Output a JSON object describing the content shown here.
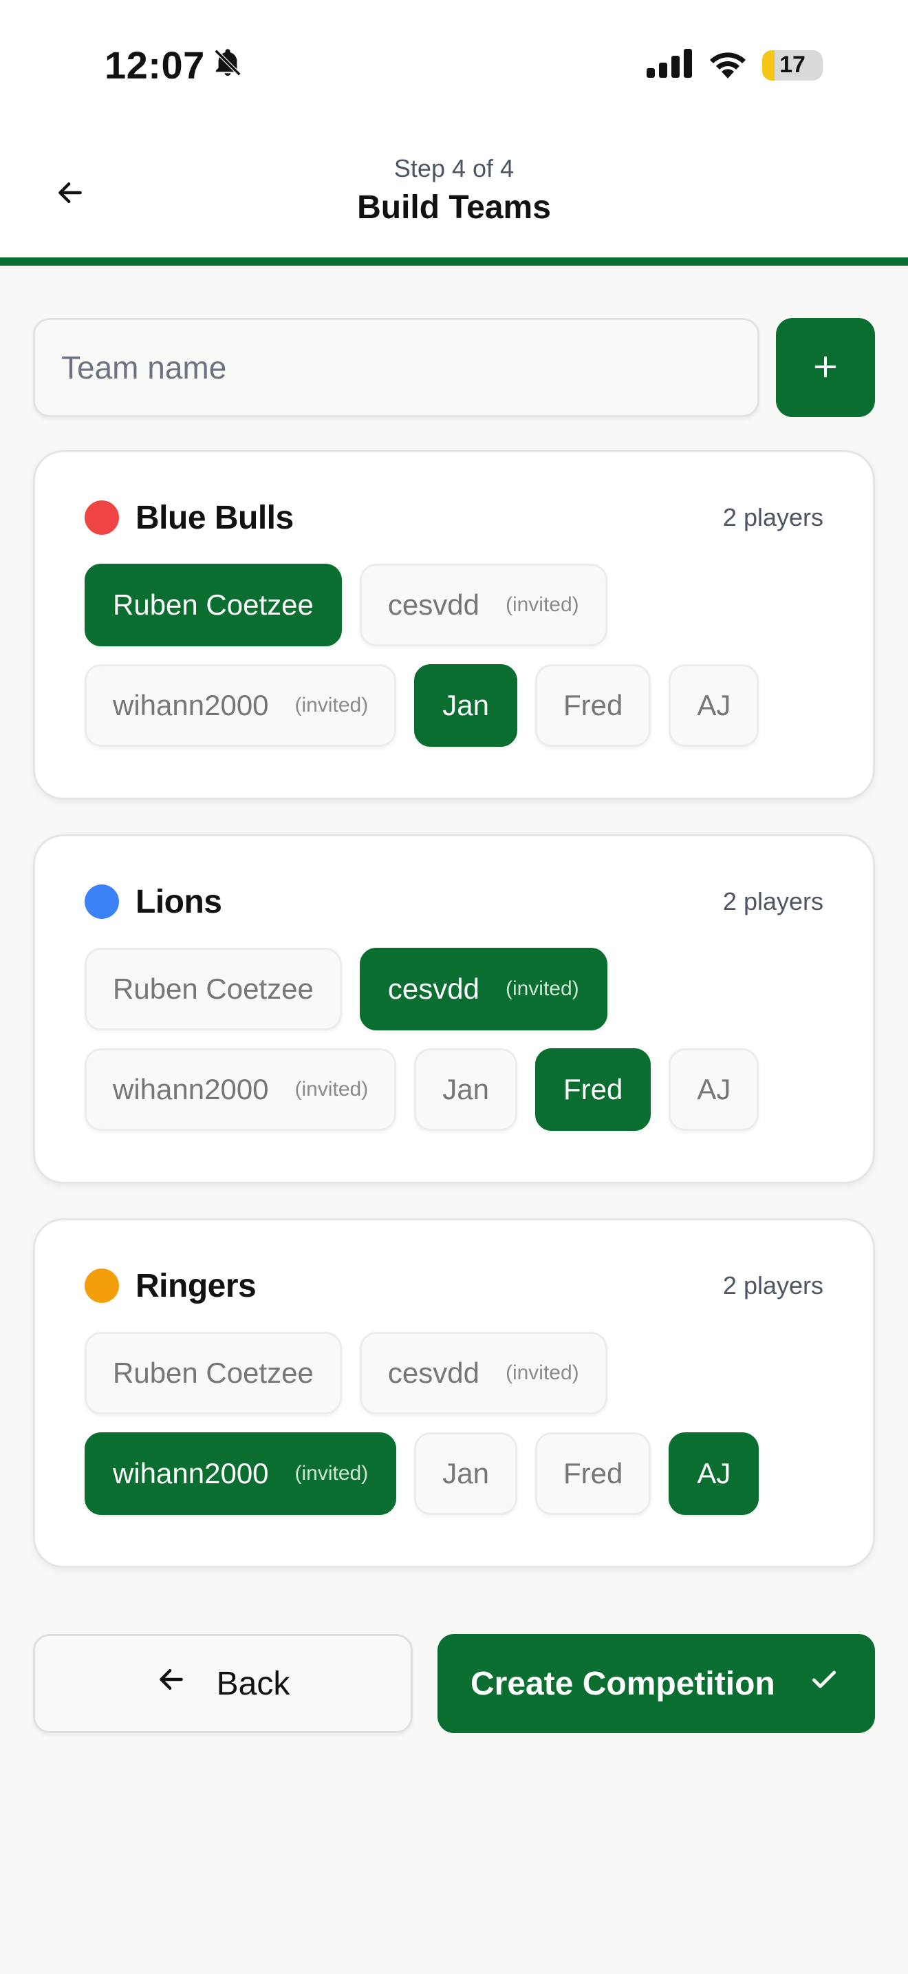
{
  "status_bar": {
    "time": "12:07",
    "battery_level": "17",
    "icons": [
      "bell-slash-icon",
      "cellular-signal-icon",
      "wifi-icon",
      "battery-icon"
    ]
  },
  "header": {
    "step": "Step 4 of 4",
    "title": "Build Teams",
    "back_icon": "arrow-left-icon"
  },
  "colors": {
    "brand_green": "#0a6e31",
    "team_red": "#ef4444",
    "team_blue": "#3b82f6",
    "team_orange": "#f59e0b"
  },
  "add_team": {
    "placeholder": "Team name",
    "value": "",
    "button_icon": "plus-icon"
  },
  "teams": [
    {
      "name": "Blue Bulls",
      "color": "#ef4444",
      "count": "2 players",
      "players": [
        {
          "name": "Ruben Coetzee",
          "tag": "",
          "selected": true
        },
        {
          "name": "cesvdd",
          "tag": "(invited)",
          "selected": false
        },
        {
          "name": "wihann2000",
          "tag": "(invited)",
          "selected": false
        },
        {
          "name": "Jan",
          "tag": "",
          "selected": true
        },
        {
          "name": "Fred",
          "tag": "",
          "selected": false
        },
        {
          "name": "AJ",
          "tag": "",
          "selected": false
        }
      ]
    },
    {
      "name": "Lions",
      "color": "#3b82f6",
      "count": "2 players",
      "players": [
        {
          "name": "Ruben Coetzee",
          "tag": "",
          "selected": false
        },
        {
          "name": "cesvdd",
          "tag": "(invited)",
          "selected": true
        },
        {
          "name": "wihann2000",
          "tag": "(invited)",
          "selected": false
        },
        {
          "name": "Jan",
          "tag": "",
          "selected": false
        },
        {
          "name": "Fred",
          "tag": "",
          "selected": true
        },
        {
          "name": "AJ",
          "tag": "",
          "selected": false
        }
      ]
    },
    {
      "name": "Ringers",
      "color": "#f59e0b",
      "count": "2 players",
      "players": [
        {
          "name": "Ruben Coetzee",
          "tag": "",
          "selected": false
        },
        {
          "name": "cesvdd",
          "tag": "(invited)",
          "selected": false
        },
        {
          "name": "wihann2000",
          "tag": "(invited)",
          "selected": true
        },
        {
          "name": "Jan",
          "tag": "",
          "selected": false
        },
        {
          "name": "Fred",
          "tag": "",
          "selected": false
        },
        {
          "name": "AJ",
          "tag": "",
          "selected": true
        }
      ]
    }
  ],
  "footer": {
    "back_label": "Back",
    "back_icon": "arrow-left-icon",
    "create_label": "Create Competition",
    "create_icon": "check-icon"
  }
}
